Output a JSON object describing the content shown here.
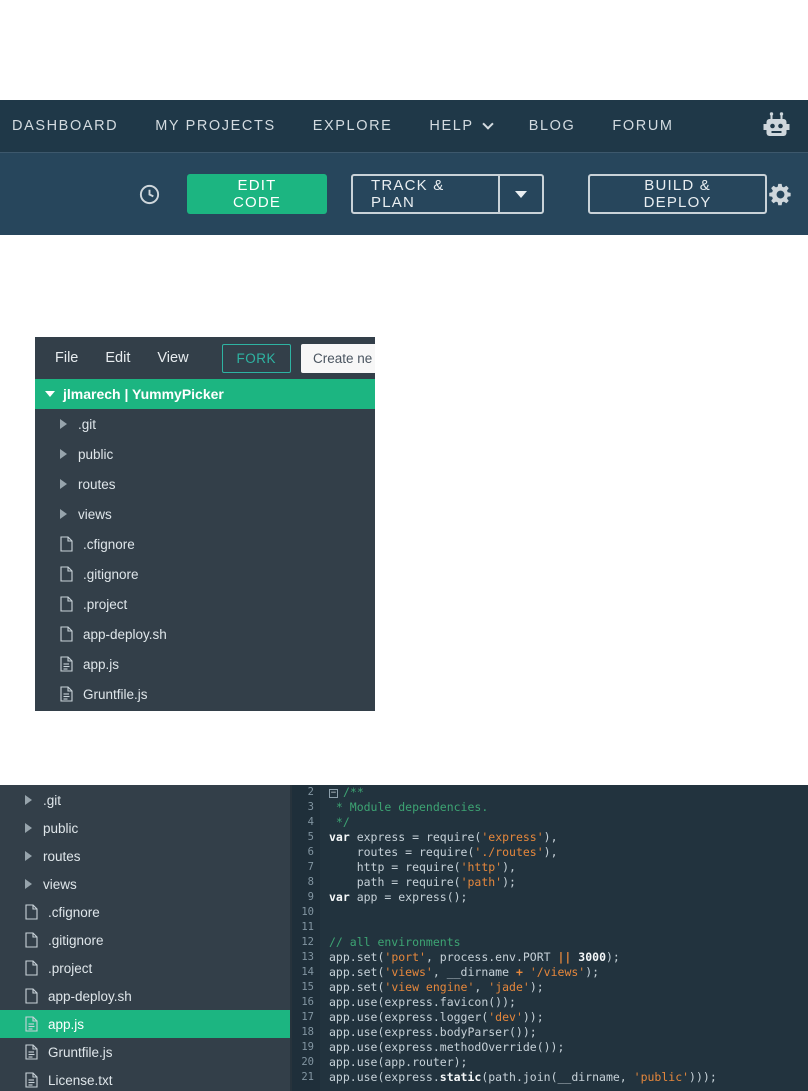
{
  "colors": {
    "accent": "#1cb581",
    "fork": "#2eb3a2",
    "topnav_bg": "#1f3848",
    "toolbar_bg": "#27465c",
    "panel_bg": "#333f49",
    "editor_bg": "#22333e",
    "gutter_bg": "#1f2f3a",
    "comment": "#3da473",
    "string": "#e5873c",
    "keyword": "#f4f7f8",
    "plain": "#c6d1d8",
    "line_number": "#8295a1"
  },
  "topnav": {
    "dashboard": "DASHBOARD",
    "my_projects": "MY PROJECTS",
    "explore": "EXPLORE",
    "help": "HELP",
    "blog": "BLOG",
    "forum": "FORUM"
  },
  "toolbar": {
    "edit_code": "EDIT CODE",
    "track_plan": "TRACK & PLAN",
    "build_deploy": "BUILD & DEPLOY"
  },
  "file_panel": {
    "menu": {
      "file": "File",
      "edit": "Edit",
      "view": "View"
    },
    "fork_label": "FORK",
    "create_label": "Create ne",
    "project_title": "jlmarech | YummyPicker",
    "tree": [
      {
        "label": ".git",
        "kind": "folder"
      },
      {
        "label": "public",
        "kind": "folder"
      },
      {
        "label": "routes",
        "kind": "folder"
      },
      {
        "label": "views",
        "kind": "folder"
      },
      {
        "label": ".cfignore",
        "kind": "file"
      },
      {
        "label": ".gitignore",
        "kind": "file"
      },
      {
        "label": ".project",
        "kind": "file"
      },
      {
        "label": "app-deploy.sh",
        "kind": "file"
      },
      {
        "label": "app.js",
        "kind": "file-code"
      },
      {
        "label": "Gruntfile.js",
        "kind": "file-code"
      }
    ]
  },
  "bottom_panel": {
    "tree": [
      {
        "label": ".git",
        "kind": "folder"
      },
      {
        "label": "public",
        "kind": "folder"
      },
      {
        "label": "routes",
        "kind": "folder"
      },
      {
        "label": "views",
        "kind": "folder"
      },
      {
        "label": ".cfignore",
        "kind": "file"
      },
      {
        "label": ".gitignore",
        "kind": "file"
      },
      {
        "label": ".project",
        "kind": "file"
      },
      {
        "label": "app-deploy.sh",
        "kind": "file"
      },
      {
        "label": "app.js",
        "kind": "file-code",
        "selected": true
      },
      {
        "label": "Gruntfile.js",
        "kind": "file-code"
      },
      {
        "label": "License.txt",
        "kind": "file-text"
      }
    ],
    "code": {
      "lines": [
        {
          "n": 2,
          "fold": true,
          "tokens": [
            {
              "c": "cm",
              "t": "/**"
            }
          ]
        },
        {
          "n": 3,
          "tokens": [
            {
              "c": "cm",
              "t": " * Module dependencies."
            }
          ]
        },
        {
          "n": 4,
          "tokens": [
            {
              "c": "cm",
              "t": " */"
            }
          ]
        },
        {
          "n": 5,
          "tokens": [
            {
              "c": "kw",
              "t": "var"
            },
            {
              "c": "pl",
              "t": " express = require("
            },
            {
              "c": "st",
              "t": "'express'"
            },
            {
              "c": "pl",
              "t": "),"
            }
          ]
        },
        {
          "n": 6,
          "tokens": [
            {
              "c": "pl",
              "t": "    routes = require("
            },
            {
              "c": "st",
              "t": "'./routes'"
            },
            {
              "c": "pl",
              "t": "),"
            }
          ]
        },
        {
          "n": 7,
          "tokens": [
            {
              "c": "pl",
              "t": "    http = require("
            },
            {
              "c": "st",
              "t": "'http'"
            },
            {
              "c": "pl",
              "t": "),"
            }
          ]
        },
        {
          "n": 8,
          "tokens": [
            {
              "c": "pl",
              "t": "    path = require("
            },
            {
              "c": "st",
              "t": "'path'"
            },
            {
              "c": "pl",
              "t": ");"
            }
          ]
        },
        {
          "n": 9,
          "tokens": [
            {
              "c": "kw",
              "t": "var"
            },
            {
              "c": "pl",
              "t": " app = express();"
            }
          ]
        },
        {
          "n": 10,
          "tokens": []
        },
        {
          "n": 11,
          "tokens": []
        },
        {
          "n": 12,
          "tokens": [
            {
              "c": "cm",
              "t": "// all environments"
            }
          ]
        },
        {
          "n": 13,
          "tokens": [
            {
              "c": "pl",
              "t": "app.set("
            },
            {
              "c": "st",
              "t": "'port'"
            },
            {
              "c": "pl",
              "t": ", process.env.PORT "
            },
            {
              "c": "op",
              "t": "||"
            },
            {
              "c": "pl",
              "t": " "
            },
            {
              "c": "nu",
              "t": "3000"
            },
            {
              "c": "pl",
              "t": ");"
            }
          ]
        },
        {
          "n": 14,
          "tokens": [
            {
              "c": "pl",
              "t": "app.set("
            },
            {
              "c": "st",
              "t": "'views'"
            },
            {
              "c": "pl",
              "t": ", __dirname "
            },
            {
              "c": "op",
              "t": "+"
            },
            {
              "c": "pl",
              "t": " "
            },
            {
              "c": "st",
              "t": "'/views'"
            },
            {
              "c": "pl",
              "t": ");"
            }
          ]
        },
        {
          "n": 15,
          "tokens": [
            {
              "c": "pl",
              "t": "app.set("
            },
            {
              "c": "st",
              "t": "'view engine'"
            },
            {
              "c": "pl",
              "t": ", "
            },
            {
              "c": "st",
              "t": "'jade'"
            },
            {
              "c": "pl",
              "t": ");"
            }
          ]
        },
        {
          "n": 16,
          "tokens": [
            {
              "c": "pl",
              "t": "app.use(express.favicon());"
            }
          ]
        },
        {
          "n": 17,
          "tokens": [
            {
              "c": "pl",
              "t": "app.use(express.logger("
            },
            {
              "c": "st",
              "t": "'dev'"
            },
            {
              "c": "pl",
              "t": "));"
            }
          ]
        },
        {
          "n": 18,
          "tokens": [
            {
              "c": "pl",
              "t": "app.use(express.bodyParser());"
            }
          ]
        },
        {
          "n": 19,
          "tokens": [
            {
              "c": "pl",
              "t": "app.use(express.methodOverride());"
            }
          ]
        },
        {
          "n": 20,
          "tokens": [
            {
              "c": "pl",
              "t": "app.use(app.router);"
            }
          ]
        },
        {
          "n": 21,
          "tokens": [
            {
              "c": "pl",
              "t": "app.use(express."
            },
            {
              "c": "kw",
              "t": "static"
            },
            {
              "c": "pl",
              "t": "(path.join(__dirname, "
            },
            {
              "c": "st",
              "t": "'public'"
            },
            {
              "c": "pl",
              "t": ")));"
            }
          ]
        }
      ]
    }
  }
}
